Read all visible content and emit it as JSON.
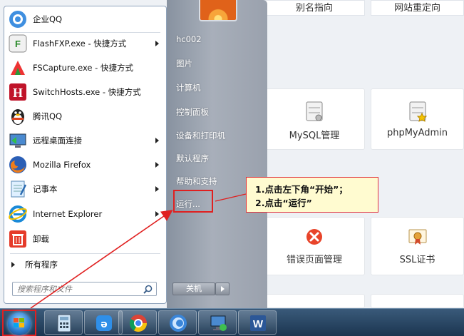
{
  "background": {
    "col_headers": [
      "别名指向",
      "网站重定向"
    ],
    "tiles": [
      {
        "label": "MySQL管理",
        "icon": "database-icon"
      },
      {
        "label": "phpMyAdmin",
        "icon": "database-star-icon"
      },
      {
        "label": "错误页面管理",
        "icon": "error-icon"
      },
      {
        "label": "SSL证书",
        "icon": "certificate-icon"
      }
    ]
  },
  "start_menu": {
    "programs": [
      {
        "label": "企业QQ",
        "icon": "enterprise-qq-icon",
        "has_submenu": false
      },
      {
        "label": "FlashFXP.exe - 快捷方式",
        "icon": "flashfxp-icon",
        "has_submenu": true
      },
      {
        "label": "FSCapture.exe - 快捷方式",
        "icon": "fscapture-icon",
        "has_submenu": false
      },
      {
        "label": "SwitchHosts.exe - 快捷方式",
        "icon": "switchhosts-icon",
        "has_submenu": false
      },
      {
        "label": "腾讯QQ",
        "icon": "qq-penguin-icon",
        "has_submenu": false
      },
      {
        "label": "远程桌面连接",
        "icon": "remote-desktop-icon",
        "has_submenu": true
      },
      {
        "label": "Mozilla Firefox",
        "icon": "firefox-icon",
        "has_submenu": true
      },
      {
        "label": "记事本",
        "icon": "notepad-icon",
        "has_submenu": true
      },
      {
        "label": "Internet Explorer",
        "icon": "ie-icon",
        "has_submenu": true
      },
      {
        "label": "卸载",
        "icon": "uninstall-icon",
        "has_submenu": false
      }
    ],
    "all_programs": "所有程序",
    "search_placeholder": "搜索程序和文件",
    "right_items": [
      "hc002",
      "图片",
      "计算机",
      "控制面板",
      "设备和打印机",
      "默认程序",
      "帮助和支持",
      "运行..."
    ],
    "shutdown_label": "关机"
  },
  "callout": {
    "line1": "1.点击左下角“开始”；",
    "line2": "2.点击“运行”"
  },
  "taskbar": {
    "items": [
      "calculator-icon",
      "baidu-browser-icon",
      "chrome-icon",
      "browser-c-icon",
      "remote-network-icon",
      "word-icon"
    ]
  },
  "colors": {
    "highlight_red": "#e02020",
    "callout_bg": "#fffbd0"
  }
}
